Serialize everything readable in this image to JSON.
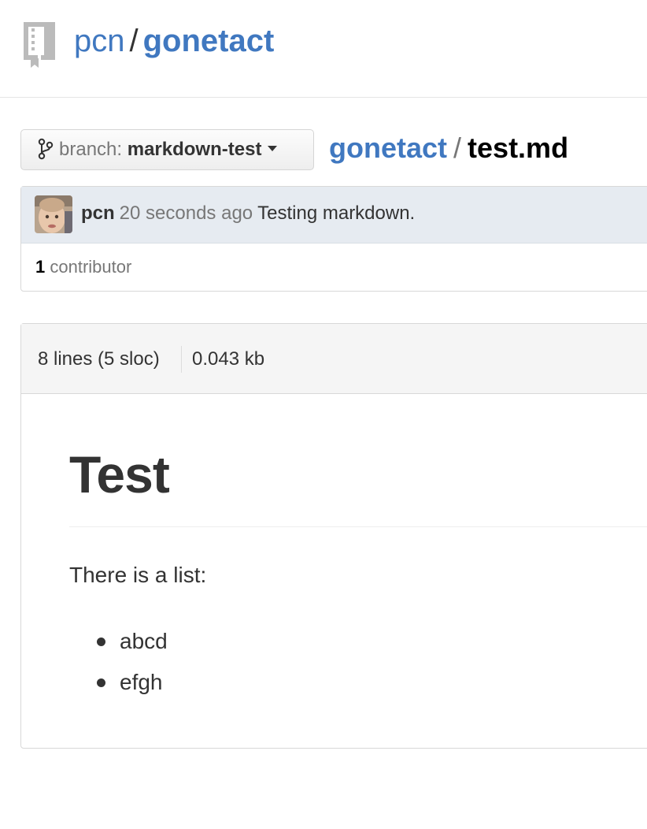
{
  "repo": {
    "owner": "pcn",
    "separator": "/",
    "name": "gonetact"
  },
  "branch": {
    "prefix": "branch:",
    "name": "markdown-test"
  },
  "breadcrumb": {
    "repo": "gonetact",
    "separator": "/",
    "file": "test.md"
  },
  "commit": {
    "author": "pcn",
    "time": "20 seconds ago",
    "message": "Testing markdown."
  },
  "contributors": {
    "count": "1",
    "label": "contributor"
  },
  "file_info": {
    "lines": "8 lines (5 sloc)",
    "size": "0.043 kb"
  },
  "markdown": {
    "heading": "Test",
    "paragraph": "There is a list:",
    "list_items": [
      "abcd",
      "efgh"
    ]
  },
  "colors": {
    "link": "#4078c0",
    "text": "#333333",
    "muted": "#777777",
    "commit_bg": "#e6ebf1"
  }
}
